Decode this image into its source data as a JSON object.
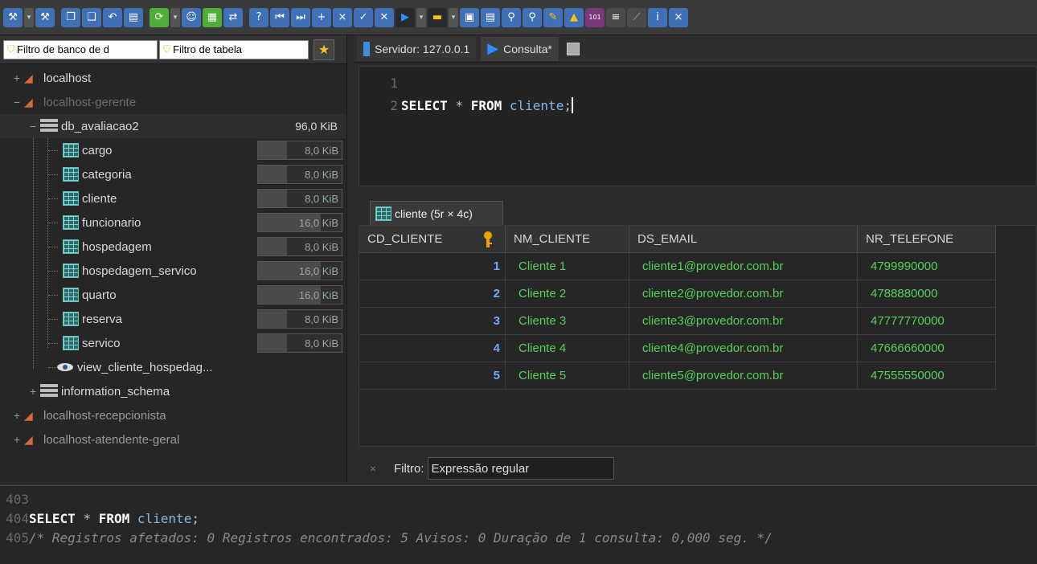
{
  "left_panel": {
    "db_filter_placeholder": "Filtro de banco de d",
    "table_filter_placeholder": "Filtro de tabela"
  },
  "tree": {
    "sessions": [
      {
        "label": "localhost",
        "expanded": false
      },
      {
        "label": "localhost-gerente",
        "expanded": true
      },
      {
        "label": "localhost-recepcionista",
        "expanded": false
      },
      {
        "label": "localhost-atendente-geral",
        "expanded": false
      }
    ],
    "database": {
      "label": "db_avaliacao2",
      "size": "96,0 KiB"
    },
    "tables": [
      {
        "label": "cargo",
        "size": "8,0 KiB",
        "fill": 0.35
      },
      {
        "label": "categoria",
        "size": "8,0 KiB",
        "fill": 0.35
      },
      {
        "label": "cliente",
        "size": "8,0 KiB",
        "fill": 0.35
      },
      {
        "label": "funcionario",
        "size": "16,0 KiB",
        "fill": 0.75
      },
      {
        "label": "hospedagem",
        "size": "8,0 KiB",
        "fill": 0.35
      },
      {
        "label": "hospedagem_servico",
        "size": "16,0 KiB",
        "fill": 0.75
      },
      {
        "label": "quarto",
        "size": "16,0 KiB",
        "fill": 0.75
      },
      {
        "label": "reserva",
        "size": "8,0 KiB",
        "fill": 0.35
      },
      {
        "label": "servico",
        "size": "8,0 KiB",
        "fill": 0.35
      }
    ],
    "view": {
      "label": "view_cliente_hospedag..."
    },
    "other_db": {
      "label": "information_schema"
    }
  },
  "tabs": [
    {
      "label": "Servidor: 127.0.0.1",
      "icon": "server-icon"
    },
    {
      "label": "Consulta*",
      "icon": "play-icon"
    }
  ],
  "editor": {
    "lines": [
      {
        "num": "1",
        "text": ""
      },
      {
        "num": "2",
        "kw1": "SELECT",
        "op": "*",
        "kw2": "FROM",
        "ident": "cliente",
        "end": ";"
      }
    ]
  },
  "result": {
    "tab_label": "cliente (5r × 4c)",
    "columns": [
      "CD_CLIENTE",
      "NM_CLIENTE",
      "DS_EMAIL",
      "NR_TELEFONE"
    ],
    "rows": [
      [
        "1",
        "Cliente 1",
        "cliente1@provedor.com.br",
        "4799990000"
      ],
      [
        "2",
        "Cliente 2",
        "cliente2@provedor.com.br",
        "4788880000"
      ],
      [
        "3",
        "Cliente 3",
        "cliente3@provedor.com.br",
        "47777770000"
      ],
      [
        "4",
        "Cliente 4",
        "cliente4@provedor.com.br",
        "47666660000"
      ],
      [
        "5",
        "Cliente 5",
        "cliente5@provedor.com.br",
        "47555550000"
      ]
    ],
    "filter_label": "Filtro:",
    "filter_placeholder": "Expressão regular"
  },
  "log": {
    "lines": [
      {
        "num": "403",
        "text": ""
      },
      {
        "num": "404",
        "kw1": "SELECT",
        "op": "*",
        "kw2": "FROM",
        "ident": "cliente",
        "end": ";"
      },
      {
        "num": "405",
        "comment": "/* Registros afetados: 0  Registros encontrados: 5  Avisos: 0  Duração de 1 consulta: 0,000 seg. */"
      }
    ]
  },
  "colors": {
    "number": "#6fa8ff",
    "text_value": "#55d15a",
    "identifier": "#83bbe6",
    "accent_orange": "#f6a000"
  }
}
